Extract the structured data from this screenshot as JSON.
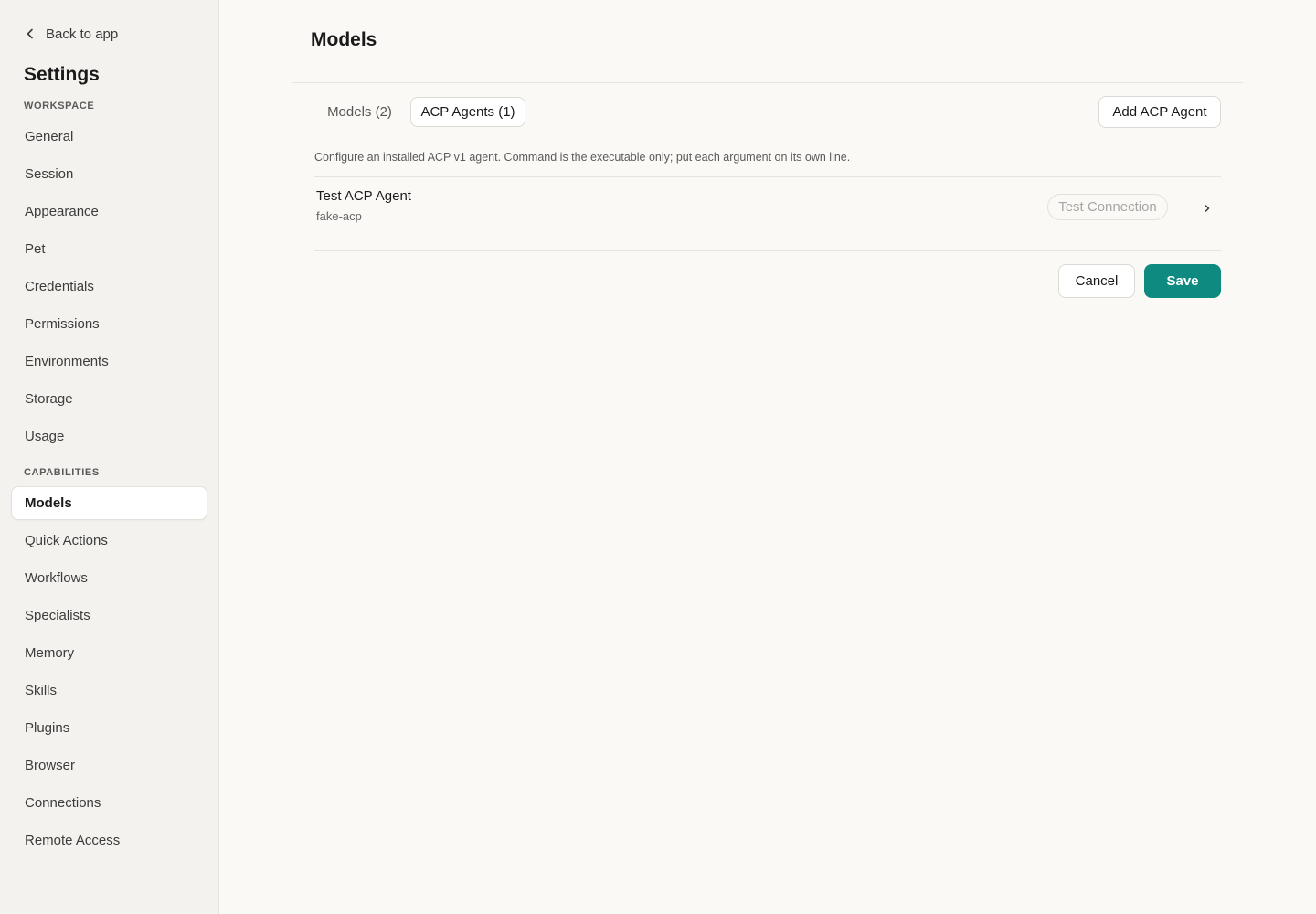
{
  "sidebar": {
    "back_label": "Back to app",
    "title": "Settings",
    "sections": [
      {
        "label": "WORKSPACE",
        "items": [
          {
            "label": "General"
          },
          {
            "label": "Session"
          },
          {
            "label": "Appearance"
          },
          {
            "label": "Pet"
          },
          {
            "label": "Credentials"
          },
          {
            "label": "Permissions"
          },
          {
            "label": "Environments"
          },
          {
            "label": "Storage"
          },
          {
            "label": "Usage"
          }
        ]
      },
      {
        "label": "CAPABILITIES",
        "items": [
          {
            "label": "Models",
            "active": true
          },
          {
            "label": "Quick Actions"
          },
          {
            "label": "Workflows"
          },
          {
            "label": "Specialists"
          },
          {
            "label": "Memory"
          },
          {
            "label": "Skills"
          },
          {
            "label": "Plugins"
          },
          {
            "label": "Browser"
          },
          {
            "label": "Connections"
          },
          {
            "label": "Remote Access"
          }
        ]
      }
    ]
  },
  "main": {
    "title": "Models",
    "tabs": [
      {
        "label": "Models (2)",
        "active": false
      },
      {
        "label": "ACP Agents (1)",
        "active": true
      }
    ],
    "add_button_label": "Add ACP Agent",
    "description": "Configure an installed ACP v1 agent. Command is the executable only; put each argument on its own line.",
    "agents": [
      {
        "name": "Test ACP Agent",
        "command": "fake-acp",
        "test_label": "Test Connection"
      }
    ],
    "cancel_label": "Cancel",
    "save_label": "Save"
  },
  "colors": {
    "accent": "#0f8a80",
    "background": "#faf9f6",
    "sidebar_background": "#f3f2ee"
  },
  "icons": {
    "back": "chevron-left-icon",
    "row_expand": "chevron-right-icon"
  }
}
